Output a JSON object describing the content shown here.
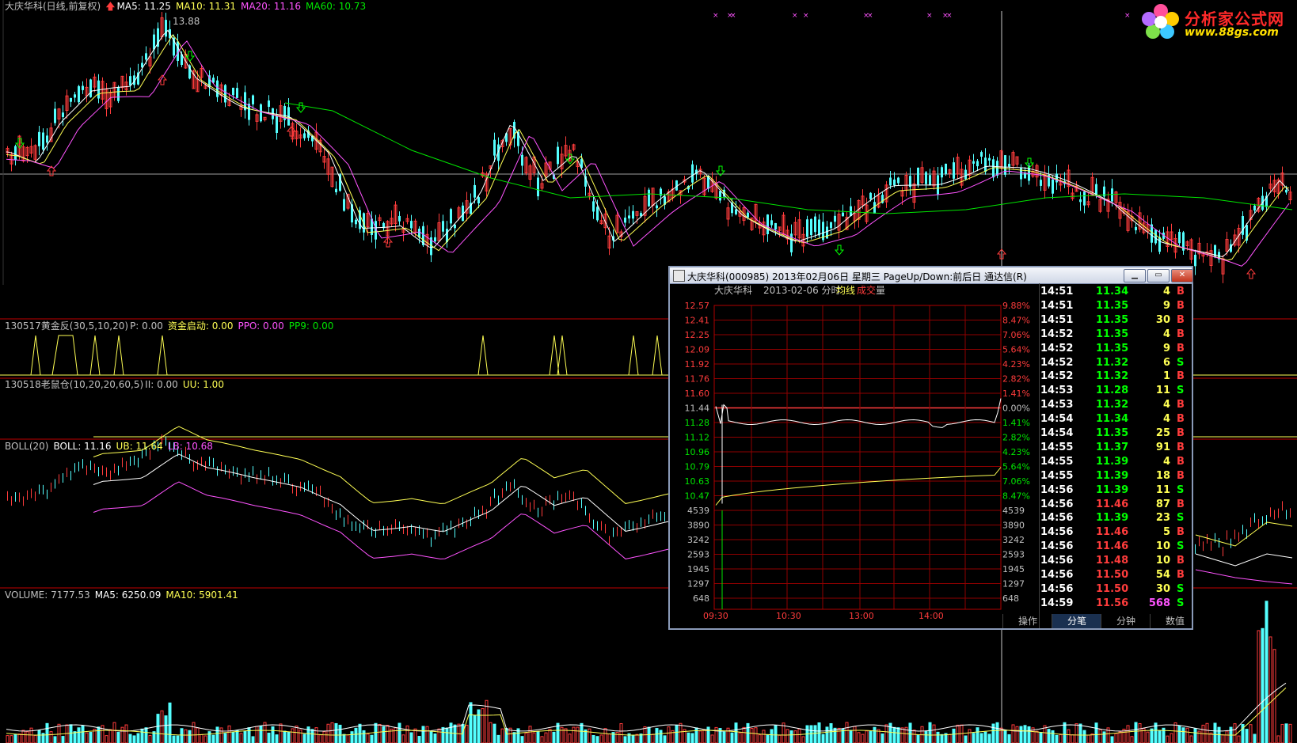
{
  "main_header": {
    "title": "大庆华科(日线,前复权)",
    "ma5": "MA5: 11.25",
    "ma10": "MA10: 11.31",
    "ma20": "MA20: 11.16",
    "ma60": "MA60: 10.73",
    "high_label": "13.88"
  },
  "ind1_header": {
    "name": "130517黄金反(30,5,10,20)",
    "p": "P: 0.00",
    "zj": "资金启动: 0.00",
    "ppo": "PPO: 0.00",
    "pp9": "PP9: 0.00"
  },
  "ind2_header": {
    "name": "130518老鼠仓(10,20,20,60,5)",
    "ii": "II: 0.00",
    "uu": "UU: 1.00"
  },
  "boll_header": {
    "name": "BOLL(20)",
    "boll": "BOLL: 11.16",
    "ub": "UB: 11.64",
    "lb": "LB: 10.68"
  },
  "vol_header": {
    "volume": "VOLUME: 7177.53",
    "ma5": "MA5: 6250.09",
    "ma10": "MA10: 5901.41"
  },
  "logo": {
    "name": "分析家公式网",
    "url_text": "www.88gs.com"
  },
  "colors": {
    "up": "#ff3c3c",
    "down": "#54ffff",
    "ma5": "#ffffff",
    "ma10": "#ffff54",
    "ma20": "#ff54ff",
    "ma60": "#00e600",
    "grid": "#c00000",
    "green_text": "#00ff00",
    "red_text": "#ff3c3c"
  },
  "popup": {
    "title": "大庆华科(000985) 2013年02月06日 星期三 PageUp/Down:前后日 通达信(R)",
    "chart_header": {
      "name": "大庆华科",
      "date": "2013-02-06 分时",
      "avg": "均线",
      "vol": "成交",
      "vol2": "量"
    },
    "price_labels": [
      "12.57",
      "12.41",
      "12.25",
      "12.09",
      "11.92",
      "11.76",
      "11.60",
      "11.44",
      "11.28",
      "11.12",
      "10.96",
      "10.79",
      "10.63",
      "10.47"
    ],
    "pct_labels": [
      "9.88%",
      "8.47%",
      "7.06%",
      "5.64%",
      "4.23%",
      "2.82%",
      "1.41%",
      "0.00%",
      "1.41%",
      "2.82%",
      "4.23%",
      "5.64%",
      "7.06%",
      "8.47%"
    ],
    "vol_labels": [
      "4539",
      "3890",
      "3242",
      "2593",
      "1945",
      "1297",
      "648"
    ],
    "time_labels": [
      "09:30",
      "10:30",
      "13:00",
      "14:00"
    ],
    "ticks": [
      {
        "time": "14:51",
        "price": "11.34",
        "vol": "4",
        "side": "B",
        "color": "green"
      },
      {
        "time": "14:51",
        "price": "11.35",
        "vol": "9",
        "side": "B",
        "color": "green"
      },
      {
        "time": "14:51",
        "price": "11.35",
        "vol": "30",
        "side": "B",
        "color": "green"
      },
      {
        "time": "14:52",
        "price": "11.35",
        "vol": "4",
        "side": "B",
        "color": "green"
      },
      {
        "time": "14:52",
        "price": "11.35",
        "vol": "9",
        "side": "B",
        "color": "green"
      },
      {
        "time": "14:52",
        "price": "11.32",
        "vol": "6",
        "side": "S",
        "color": "green"
      },
      {
        "time": "14:52",
        "price": "11.32",
        "vol": "1",
        "side": "B",
        "color": "green"
      },
      {
        "time": "14:53",
        "price": "11.28",
        "vol": "11",
        "side": "S",
        "color": "green"
      },
      {
        "time": "14:53",
        "price": "11.32",
        "vol": "4",
        "side": "B",
        "color": "green"
      },
      {
        "time": "14:54",
        "price": "11.34",
        "vol": "4",
        "side": "B",
        "color": "green"
      },
      {
        "time": "14:54",
        "price": "11.35",
        "vol": "25",
        "side": "B",
        "color": "green"
      },
      {
        "time": "14:55",
        "price": "11.37",
        "vol": "91",
        "side": "B",
        "color": "green"
      },
      {
        "time": "14:55",
        "price": "11.39",
        "vol": "4",
        "side": "B",
        "color": "green"
      },
      {
        "time": "14:55",
        "price": "11.39",
        "vol": "18",
        "side": "B",
        "color": "green"
      },
      {
        "time": "14:56",
        "price": "11.39",
        "vol": "11",
        "side": "S",
        "color": "green"
      },
      {
        "time": "14:56",
        "price": "11.46",
        "vol": "87",
        "side": "B",
        "color": "red"
      },
      {
        "time": "14:56",
        "price": "11.39",
        "vol": "23",
        "side": "S",
        "color": "green"
      },
      {
        "time": "14:56",
        "price": "11.46",
        "vol": "5",
        "side": "B",
        "color": "red"
      },
      {
        "time": "14:56",
        "price": "11.46",
        "vol": "10",
        "side": "S",
        "color": "red"
      },
      {
        "time": "14:56",
        "price": "11.48",
        "vol": "10",
        "side": "B",
        "color": "red"
      },
      {
        "time": "14:56",
        "price": "11.50",
        "vol": "54",
        "side": "B",
        "color": "red"
      },
      {
        "time": "14:56",
        "price": "11.50",
        "vol": "30",
        "side": "S",
        "color": "red"
      },
      {
        "time": "14:59",
        "price": "11.56",
        "vol": "568",
        "side": "S",
        "color": "red"
      }
    ],
    "tabs": [
      "操作",
      "分笔",
      "分钟",
      "数值"
    ],
    "active_tab": "分笔"
  }
}
